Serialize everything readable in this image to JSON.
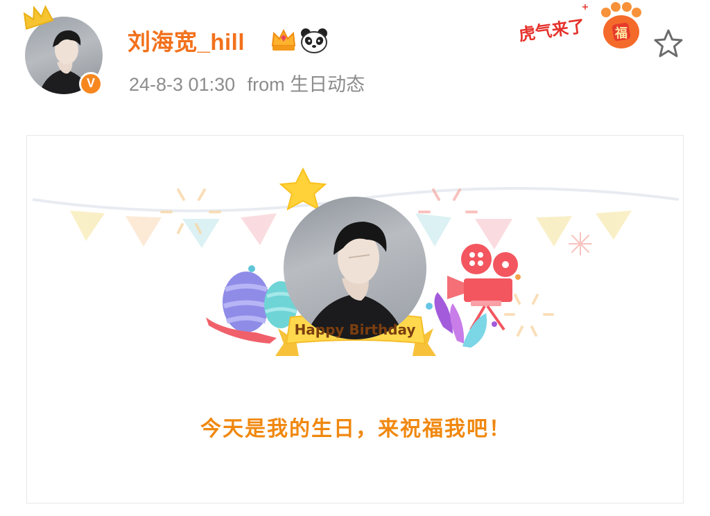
{
  "post": {
    "username": "刘海宽_hill",
    "timestamp": "24-8-3 01:30",
    "from_label": "from",
    "source": "生日动态",
    "verified_mark": "V"
  },
  "decor": {
    "tiger_text": "虎气来了",
    "fu_char": "福"
  },
  "card": {
    "banner": "Happy Birthday",
    "greeting": "今天是我的生日，来祝福我吧！"
  },
  "colors": {
    "username": "#f2711c",
    "meta": "#8c8c8c",
    "greeting": "#f0880f",
    "verified": "#f6871f"
  }
}
